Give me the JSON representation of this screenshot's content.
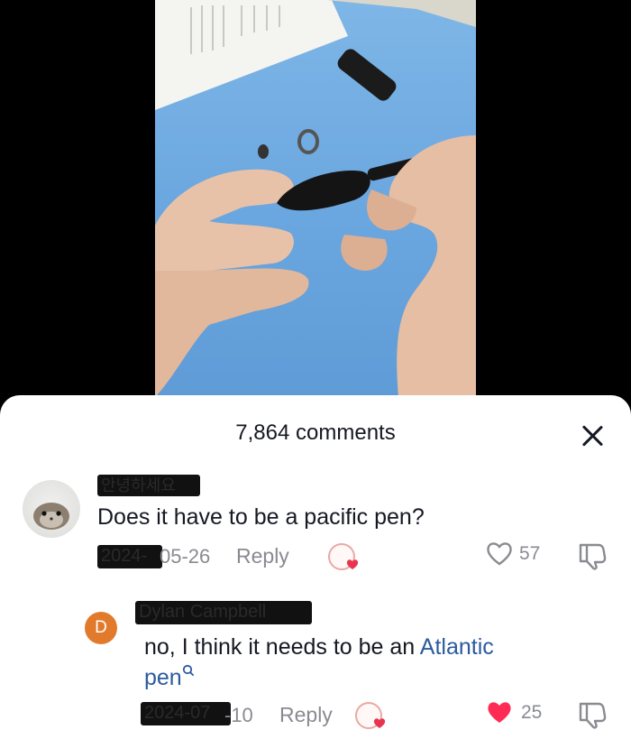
{
  "sheet": {
    "title": "7,864 comments"
  },
  "comments": [
    {
      "username": "안녕하세요",
      "text": "Does it have to be a pacific pen?",
      "date_hidden": "2024-",
      "date_visible": "05-26",
      "reply_label": "Reply",
      "like_count": "57",
      "liked": false
    },
    {
      "avatar_initial": "D",
      "username": "Dylan Campbell",
      "text_prefix": "no, I think it needs to be an ",
      "text_link": "Atlantic",
      "text_link_tail": "pen",
      "date_hidden": "2024-07",
      "date_visible": "-10",
      "reply_label": "Reply",
      "like_count": "25",
      "liked": true
    }
  ],
  "icons": [
    "close-icon",
    "heart-outline-icon",
    "heart-filled-icon",
    "dislike-icon",
    "sticker-icon",
    "search-icon"
  ],
  "colors": {
    "accent_link": "#2b5b9e",
    "liked_heart": "#fe2c55",
    "avatar_d": "#e27a2b"
  }
}
